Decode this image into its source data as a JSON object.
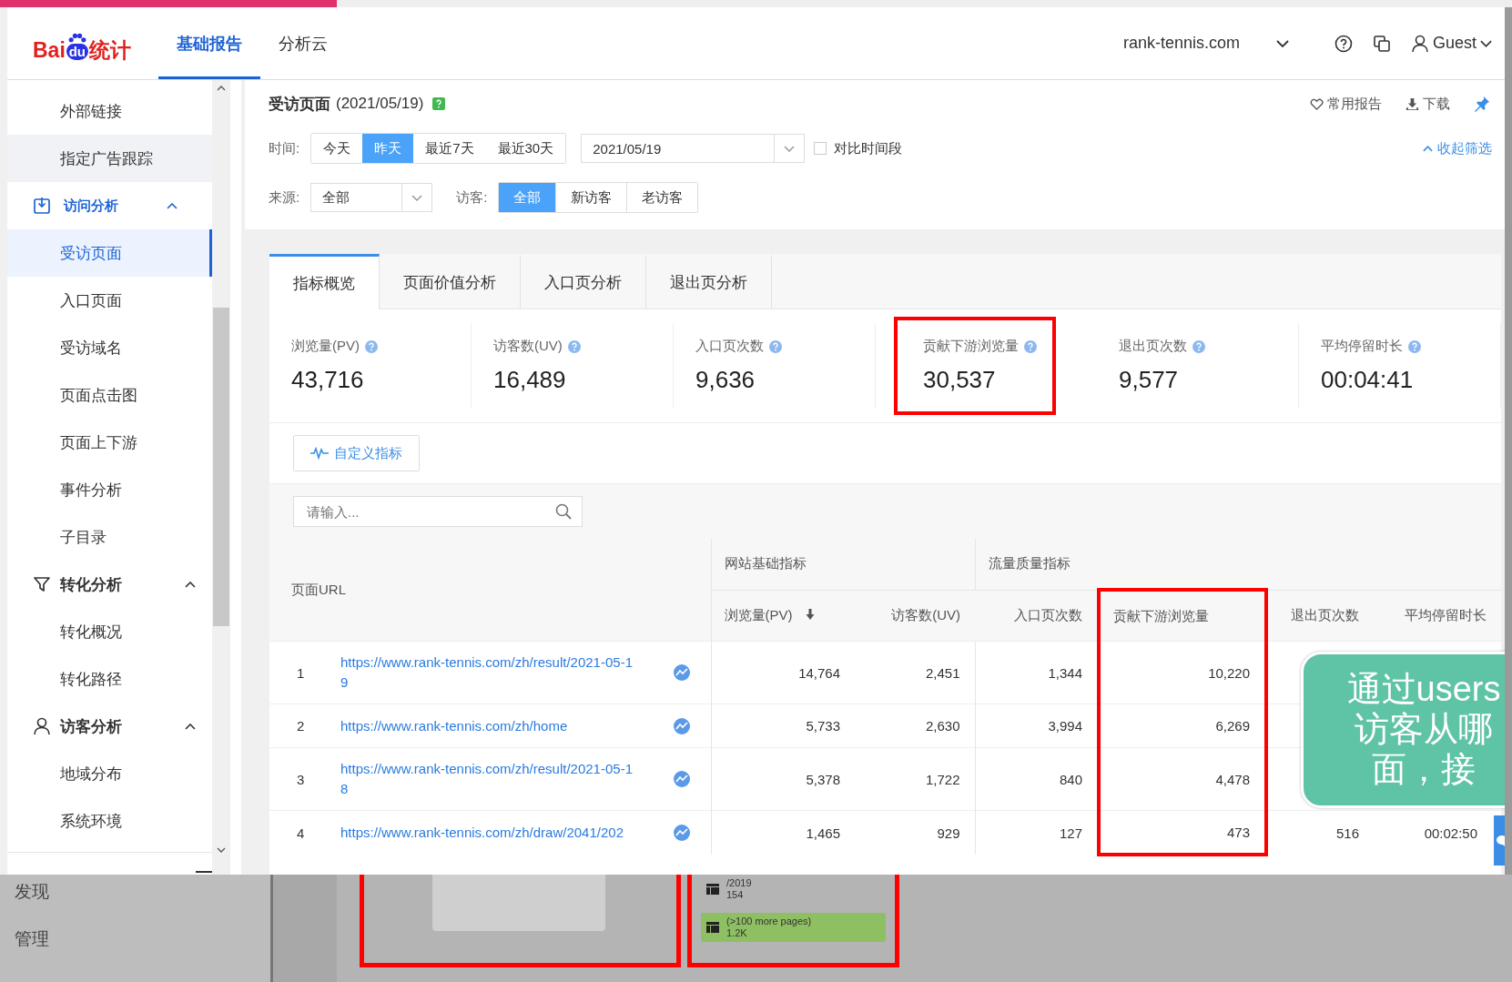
{
  "header": {
    "logo": {
      "left": "Bai",
      "mid": "du",
      "right": "统计"
    },
    "nav": [
      {
        "label": "基础报告",
        "selected": true
      },
      {
        "label": "分析云",
        "selected": false
      }
    ],
    "site": "rank-tennis.com",
    "user": "Guest"
  },
  "sidebar": {
    "items": [
      {
        "kind": "item",
        "label": "外部链接",
        "selected": false,
        "hovered": false
      },
      {
        "kind": "item",
        "label": "指定广告跟踪",
        "selected": false,
        "hovered": true
      },
      {
        "kind": "group",
        "label": "访问分析",
        "expanded": true,
        "active": true
      },
      {
        "kind": "item",
        "label": "受访页面",
        "selected": true,
        "hovered": false
      },
      {
        "kind": "item",
        "label": "入口页面",
        "selected": false,
        "hovered": false
      },
      {
        "kind": "item",
        "label": "受访域名",
        "selected": false,
        "hovered": false
      },
      {
        "kind": "item",
        "label": "页面点击图",
        "selected": false,
        "hovered": false
      },
      {
        "kind": "item",
        "label": "页面上下游",
        "selected": false,
        "hovered": false
      },
      {
        "kind": "item",
        "label": "事件分析",
        "selected": false,
        "hovered": false
      },
      {
        "kind": "item",
        "label": "子目录",
        "selected": false,
        "hovered": false
      },
      {
        "kind": "group",
        "label": "转化分析",
        "expanded": true,
        "active": false
      },
      {
        "kind": "item",
        "label": "转化概况",
        "selected": false,
        "hovered": false
      },
      {
        "kind": "item",
        "label": "转化路径",
        "selected": false,
        "hovered": false
      },
      {
        "kind": "group",
        "label": "访客分析",
        "expanded": true,
        "active": false
      },
      {
        "kind": "item",
        "label": "地域分布",
        "selected": false,
        "hovered": false
      },
      {
        "kind": "item",
        "label": "系统环境",
        "selected": false,
        "hovered": false
      }
    ]
  },
  "report": {
    "title": "受访页面",
    "date": "(2021/05/19)",
    "actions": [
      "常用报告",
      "下载"
    ],
    "time_label": "时间:",
    "time_options": [
      {
        "label": "今天",
        "selected": false
      },
      {
        "label": "昨天",
        "selected": true
      },
      {
        "label": "最近7天",
        "selected": false
      },
      {
        "label": "最近30天",
        "selected": false
      }
    ],
    "date_field": "2021/05/19",
    "compare": {
      "label": "对比时间段",
      "checked": false
    },
    "collapse": "收起筛选",
    "source_label": "来源:",
    "source": "全部",
    "visitor_label": "访客:",
    "visitor_options": [
      {
        "label": "全部",
        "selected": true
      },
      {
        "label": "新访客",
        "selected": false
      },
      {
        "label": "老访客",
        "selected": false
      }
    ]
  },
  "tabs": [
    {
      "label": "指标概览",
      "selected": true
    },
    {
      "label": "页面价值分析",
      "selected": false
    },
    {
      "label": "入口页分析",
      "selected": false
    },
    {
      "label": "退出页分析",
      "selected": false
    }
  ],
  "metrics": [
    {
      "label": "浏览量(PV)",
      "value": "43,716",
      "highlighted": false
    },
    {
      "label": "访客数(UV)",
      "value": "16,489",
      "highlighted": false
    },
    {
      "label": "入口页次数",
      "value": "9,636",
      "highlighted": false
    },
    {
      "label": "贡献下游浏览量",
      "value": "30,537",
      "highlighted": true
    },
    {
      "label": "退出页次数",
      "value": "9,577",
      "highlighted": false
    },
    {
      "label": "平均停留时长",
      "value": "00:04:41",
      "highlighted": false
    }
  ],
  "custom_button": "自定义指标",
  "search": {
    "placeholder": "请输入..."
  },
  "table": {
    "url_header": "页面URL",
    "groups": [
      {
        "label": "网站基础指标",
        "columns": [
          {
            "label": "浏览量(PV)",
            "sorted": true,
            "highlighted": false
          },
          {
            "label": "访客数(UV)",
            "sorted": false,
            "highlighted": false
          }
        ]
      },
      {
        "label": "流量质量指标",
        "columns": [
          {
            "label": "入口页次数",
            "sorted": false,
            "highlighted": false
          },
          {
            "label": "贡献下游浏览量",
            "sorted": false,
            "highlighted": true
          },
          {
            "label": "退出页次数",
            "sorted": false,
            "highlighted": false
          },
          {
            "label": "平均停留时长",
            "sorted": false,
            "highlighted": false
          }
        ]
      }
    ],
    "rows": [
      {
        "rank": "1",
        "url": "https://www.rank-tennis.com/zh/result/2021-05-19",
        "values": [
          "14,764",
          "2,451",
          "1,344",
          "10,220"
        ]
      },
      {
        "rank": "2",
        "url": "https://www.rank-tennis.com/zh/home",
        "values": [
          "5,733",
          "2,630",
          "3,994",
          "6,269"
        ]
      },
      {
        "rank": "3",
        "url": "https://www.rank-tennis.com/zh/result/2021-05-18",
        "values": [
          "5,378",
          "1,722",
          "840",
          "4,478"
        ]
      },
      {
        "rank": "4",
        "url": "https://www.rank-tennis.com/zh/draw/2041/202",
        "values": [
          "1,465",
          "929",
          "127",
          "473",
          "516",
          "00:02:50"
        ]
      }
    ]
  },
  "callout": {
    "lines": [
      "通过users",
      "访客从哪",
      "面，接"
    ]
  },
  "background": {
    "menu": [
      "发现",
      "管理"
    ],
    "nodes": [
      {
        "label": "/2019",
        "value": "154",
        "kind": "plain"
      },
      {
        "label": "(>100 more pages)",
        "value": "1.2K",
        "kind": "bar"
      }
    ]
  }
}
